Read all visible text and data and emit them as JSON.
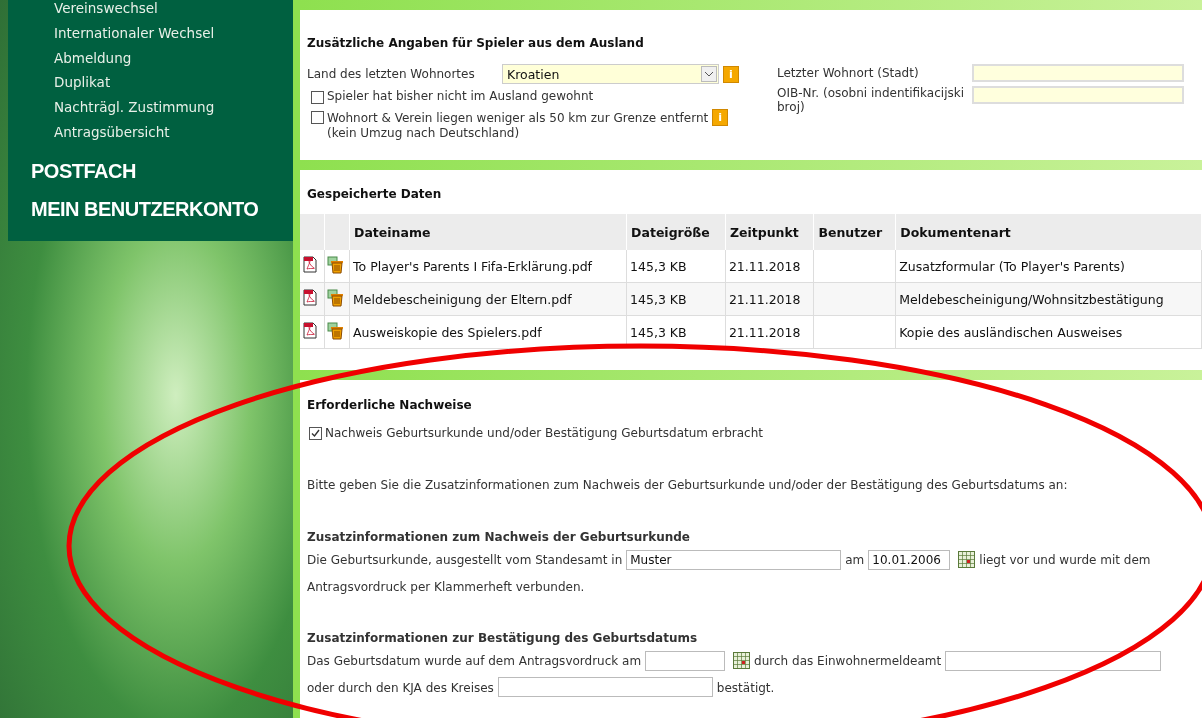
{
  "sidebar": {
    "items": [
      "Vereinswechsel",
      "Internationaler Wechsel",
      "Abmeldung",
      "Duplikat",
      "Nachträgl. Zustimmung",
      "Antragsübersicht"
    ],
    "main_links": [
      "POSTFACH",
      "MEIN BENUTZERKONTO"
    ]
  },
  "foreign": {
    "title": "Zusätzliche Angaben für Spieler aus dem Ausland",
    "country": {
      "label": "Land des letzten Wohnortes",
      "value": "Kroatien",
      "info": "i"
    },
    "checkboxes": [
      {
        "label": "Spieler hat bisher nicht im Ausland gewohnt",
        "checked": false
      },
      {
        "label": "Wohnort & Verein liegen weniger als 50 km zur Grenze entfernt",
        "note": "(kein Umzug nach Deutschland)",
        "checked": false,
        "info": "i"
      }
    ],
    "city": {
      "label": "Letzter Wohnort (Stadt)"
    },
    "oib": {
      "label": "OIB-Nr. (osobni indentifikacijski broj)"
    }
  },
  "files": {
    "title": "Gespeicherte Daten",
    "columns": [
      "Dateiname",
      "Dateigröße",
      "Zeitpunkt",
      "Benutzer",
      "Dokumentenart"
    ],
    "rows": [
      {
        "filename": "To Player's Parents I Fifa-Erklärung.pdf",
        "size": "145,3 KB",
        "date": "21.11.2018",
        "type": "Zusatzformular (To Player's Parents)"
      },
      {
        "filename": "Meldebescheinigung der Eltern.pdf",
        "size": "145,3 KB",
        "date": "21.11.2018",
        "type": "Meldebescheinigung/Wohnsitzbestätigung"
      },
      {
        "filename": "Ausweiskopie des Spielers.pdf",
        "size": "145,3 KB",
        "date": "21.11.2018",
        "type": "Kopie des ausländischen Ausweises"
      }
    ]
  },
  "proof": {
    "title": "Erforderliche Nachweise",
    "checkbox": {
      "label": "Nachweis Geburtsurkunde und/oder Bestätigung Geburtsdatum erbracht",
      "checked": true
    },
    "instruction": "Bitte geben Sie die Zusatzinformationen zum Nachweis der Geburtsurkunde und/oder der Bestätigung des Geburtsdatums an:",
    "birth_certificate": {
      "title": "Zusatzinformationen zum Nachweis der Geburtsurkunde",
      "text_1": "Die Geburtsurkunde, ausgestellt vom Standesamt in",
      "place": "Muster",
      "text_2": "am",
      "date": "10.01.2006",
      "text_3": "liegt vor und wurde mit dem",
      "text_4": "Antragsvordruck per Klammerheft verbunden."
    },
    "birth_date": {
      "title": "Zusatzinformationen zur Bestätigung des Geburtsdatums",
      "text_1": "Das Geburtsdatum wurde auf dem Antragsvordruck am",
      "text_2": "durch das Einwohnermeldeamt",
      "text_3": "oder durch den KJA des Kreises",
      "text_4": "bestätigt."
    }
  }
}
